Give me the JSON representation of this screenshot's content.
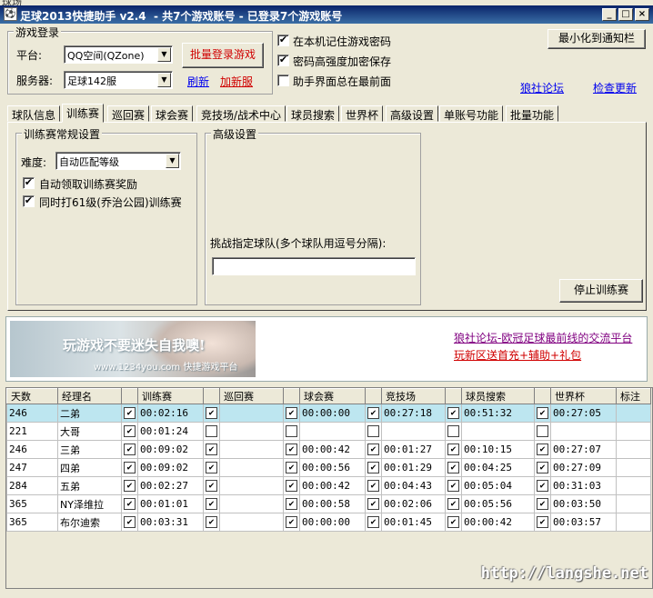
{
  "window": {
    "corner_label": "球场",
    "title": "足球2013快捷助手 v2.4  - 共7个游戏账号 - 已登录7个游戏账号"
  },
  "login": {
    "group_title": "游戏登录",
    "platform_label": "平台:",
    "platform_value": "QQ空间(QZone)",
    "server_label": "服务器:",
    "server_value": "足球142服",
    "batch_login_button": "批量登录游戏",
    "refresh_link": "刷新",
    "add_server_link": "加新服"
  },
  "options": {
    "remember_password": "在本机记住游戏密码",
    "strong_encrypt": "密码高强度加密保存",
    "always_on_top": "助手界面总在最前面"
  },
  "top_right": {
    "minimize_button": "最小化到通知栏",
    "forum_link": "狼社论坛",
    "update_link": "检查更新"
  },
  "tabs": [
    "球队信息",
    "训练赛",
    "巡回赛",
    "球会赛",
    "竞技场/战术中心",
    "球员搜索",
    "世界杯",
    "高级设置",
    "单账号功能",
    "批量功能"
  ],
  "training": {
    "group_title": "训练赛常规设置",
    "difficulty_label": "难度:",
    "difficulty_value": "自动匹配等级",
    "auto_reward": "自动领取训练赛奖励",
    "park_training": "同时打61级(乔治公园)训练赛"
  },
  "advanced": {
    "group_title": "高级设置",
    "challenge_label": "挑战指定球队(多个球队用逗号分隔):",
    "challenge_value": ""
  },
  "stop_button": "停止训练赛",
  "banner": {
    "headline": "玩游戏不要迷失自我噢!",
    "subline": "www.1234you.com 快捷游戏平台",
    "link1": "狼社论坛-欧冠足球最前线的交流平台",
    "link2": "玩新区送首充+辅助+礼包"
  },
  "table": {
    "headers": [
      "天数",
      "经理名",
      "",
      "训练赛",
      "",
      "巡回赛",
      "",
      "球会赛",
      "",
      "竞技场",
      "",
      "球员搜索",
      "",
      "世界杯",
      "标注"
    ],
    "rows": [
      [
        "246",
        "二弟",
        "✔",
        "00:02:16",
        "✔",
        "",
        "✔",
        "00:00:00",
        "✔",
        "00:27:18",
        "✔",
        "00:51:32",
        "✔",
        "00:27:05",
        ""
      ],
      [
        "221",
        "大哥",
        "✔",
        "00:01:24",
        "",
        "",
        "",
        "",
        "",
        "",
        "",
        "",
        "",
        "",
        ""
      ],
      [
        "246",
        "三弟",
        "✔",
        "00:09:02",
        "✔",
        "",
        "✔",
        "00:00:42",
        "✔",
        "00:01:27",
        "✔",
        "00:10:15",
        "✔",
        "00:27:07",
        ""
      ],
      [
        "247",
        "四弟",
        "✔",
        "00:09:02",
        "✔",
        "",
        "✔",
        "00:00:56",
        "✔",
        "00:01:29",
        "✔",
        "00:04:25",
        "✔",
        "00:27:09",
        ""
      ],
      [
        "284",
        "五弟",
        "✔",
        "00:02:27",
        "✔",
        "",
        "✔",
        "00:00:42",
        "✔",
        "00:04:43",
        "✔",
        "00:05:04",
        "✔",
        "00:31:03",
        ""
      ],
      [
        "365",
        "NY泽维拉",
        "✔",
        "00:01:01",
        "✔",
        "",
        "✔",
        "00:00:58",
        "✔",
        "00:02:06",
        "✔",
        "00:05:56",
        "✔",
        "00:03:50",
        ""
      ],
      [
        "365",
        "布尔迪索",
        "✔",
        "00:03:31",
        "✔",
        "",
        "✔",
        "00:00:00",
        "✔",
        "00:01:45",
        "✔",
        "00:00:42",
        "✔",
        "00:03:57",
        ""
      ]
    ]
  },
  "watermark": "http://langshe.net",
  "colors": {
    "title_bar": "#0a246a",
    "selected_row": "#bde6f0",
    "link_blue": "#0000ee",
    "link_red": "#d00000"
  }
}
